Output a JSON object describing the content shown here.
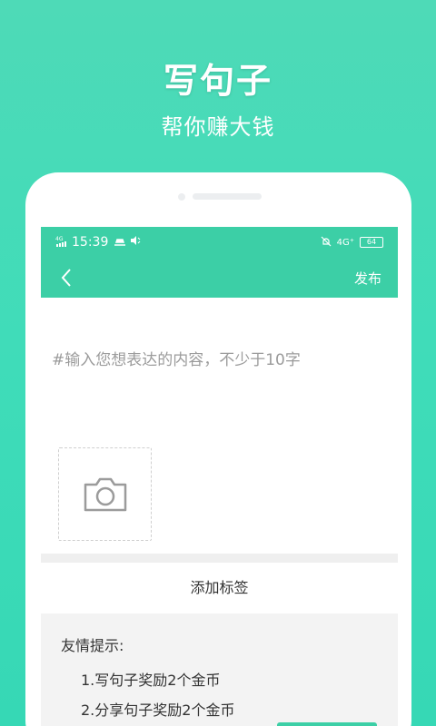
{
  "promo": {
    "title": "写句子",
    "subtitle": "帮你赚大钱"
  },
  "status_bar": {
    "network": "4G",
    "time": "15:39",
    "network_right": "4G⁺",
    "battery": "64"
  },
  "nav": {
    "publish_label": "发布"
  },
  "editor": {
    "placeholder": "#输入您想表达的内容，不少于10字"
  },
  "tags": {
    "add_label": "添加标签"
  },
  "tips": {
    "title": "友情提示:",
    "items": [
      "1.写句子奖励2个金币",
      "2.分享句子奖励2个金币"
    ]
  },
  "colors": {
    "background": "#3fdcb9",
    "app_bar": "#3ccfa6",
    "placeholder": "#9b9b9b"
  },
  "icons": {
    "back": "chevron-left-icon",
    "camera": "camera-icon",
    "mute": "mute-icon",
    "volume": "speaker-icon"
  }
}
